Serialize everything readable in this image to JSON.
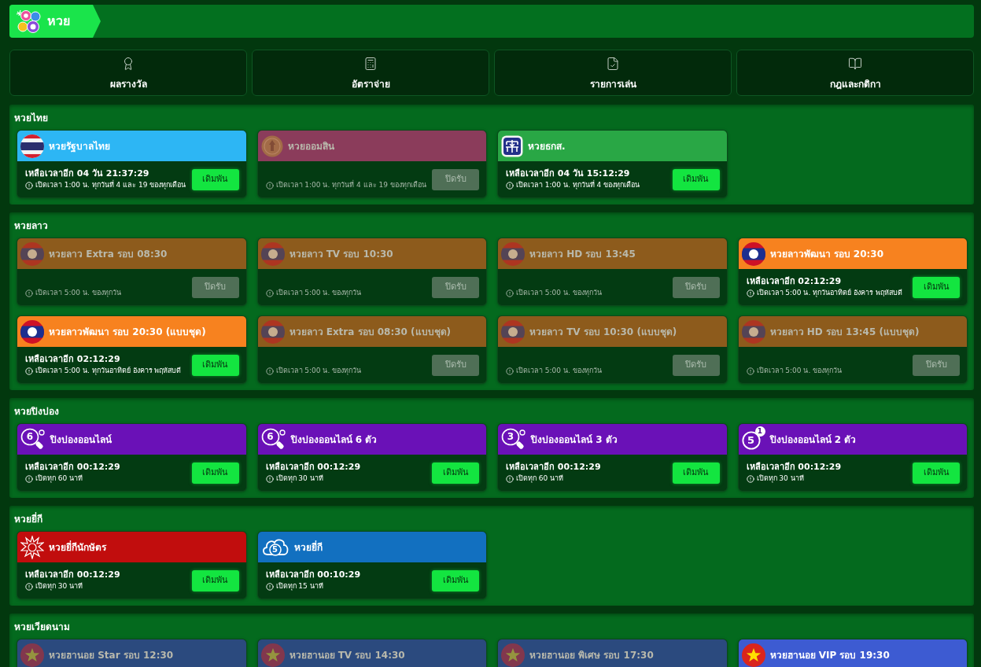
{
  "title_bar": {
    "title": "หวย"
  },
  "nav": [
    {
      "kind": "results",
      "label": "ผลรางวัล"
    },
    {
      "kind": "rates",
      "label": "อัตราจ่าย"
    },
    {
      "kind": "bets",
      "label": "รายการเล่น"
    },
    {
      "kind": "rules",
      "label": "กฎและกติกา"
    }
  ],
  "sections": [
    {
      "title": "หวยไทย",
      "cards": [
        {
          "kind": "thai",
          "name": "หวยรัฐบาลไทย",
          "color": "#2db6f4",
          "open": true,
          "countdown": "เหลือเวลาอีก 04 วัน 21:37:29",
          "schedule": "เปิดเวลา 1:00 น. ทุกวันที่ 4 และ 19 ของทุกเดือน",
          "button": "เดิมพัน"
        },
        {
          "kind": "gsb",
          "name": "หวยออมสิน",
          "color": "#8b3c5b",
          "open": false,
          "schedule": "เปิดเวลา 1:00 น. ทุกวันที่ 4 และ 19 ของทุกเดือน",
          "button": "ปิดรับ"
        },
        {
          "kind": "baac",
          "name": "หวยธกส.",
          "color": "#29a745",
          "open": true,
          "countdown": "เหลือเวลาอีก 04 วัน 15:12:29",
          "schedule": "เปิดเวลา 1:00 น. ทุกวันที่ 4 ของทุกเดือน",
          "button": "เดิมพัน"
        }
      ]
    },
    {
      "title": "หวยลาว",
      "cards": [
        {
          "kind": "lao",
          "name": "หวยลาว Extra รอบ 08:30",
          "color": "#8d5b1c",
          "open": false,
          "schedule": "เปิดเวลา 5:00 น. ของทุกวัน",
          "button": "ปิดรับ"
        },
        {
          "kind": "lao",
          "name": "หวยลาว TV รอบ 10:30",
          "color": "#8d5b1c",
          "open": false,
          "schedule": "เปิดเวลา 5:00 น. ของทุกวัน",
          "button": "ปิดรับ"
        },
        {
          "kind": "lao",
          "name": "หวยลาว HD รอบ 13:45",
          "color": "#8d5b1c",
          "open": false,
          "schedule": "เปิดเวลา 5:00 น. ของทุกวัน",
          "button": "ปิดรับ"
        },
        {
          "kind": "lao",
          "name": "หวยลาวพัฒนา รอบ 20:30",
          "color": "#f7821f",
          "open": true,
          "countdown": "เหลือเวลาอีก 02:12:29",
          "schedule": "เปิดเวลา 5:00 น. ทุกวันอาทิตย์ อังคาร พฤหัสบดี",
          "button": "เดิมพัน"
        },
        {
          "kind": "lao",
          "name": "หวยลาวพัฒนา รอบ 20:30 (แบบชุด)",
          "color": "#f7821f",
          "open": true,
          "countdown": "เหลือเวลาอีก 02:12:29",
          "schedule": "เปิดเวลา 5:00 น. ทุกวันอาทิตย์ อังคาร พฤหัสบดี",
          "button": "เดิมพัน"
        },
        {
          "kind": "lao",
          "name": "หวยลาว Extra รอบ 08:30 (แบบชุด)",
          "color": "#8d5b1c",
          "open": false,
          "schedule": "เปิดเวลา 5:00 น. ของทุกวัน",
          "button": "ปิดรับ"
        },
        {
          "kind": "lao",
          "name": "หวยลาว TV รอบ 10:30 (แบบชุด)",
          "color": "#8d5b1c",
          "open": false,
          "schedule": "เปิดเวลา 5:00 น. ของทุกวัน",
          "button": "ปิดรับ"
        },
        {
          "kind": "lao",
          "name": "หวยลาว HD รอบ 13:45 (แบบชุด)",
          "color": "#8d5b1c",
          "open": false,
          "schedule": "เปิดเวลา 5:00 น. ของทุกวัน",
          "button": "ปิดรับ"
        }
      ]
    },
    {
      "title": "หวยปิงปอง",
      "cards": [
        {
          "kind": "pingpong",
          "icon_text": "6",
          "name": "ปิงปองออนไลน์",
          "color": "#6a11b7",
          "open": true,
          "countdown": "เหลือเวลาอีก 00:12:29",
          "schedule": "เปิดทุก 60 นาที",
          "button": "เดิมพัน"
        },
        {
          "kind": "pingpong",
          "icon_text": "6",
          "name": "ปิงปองออนไลน์ 6 ตัว",
          "color": "#6a11b7",
          "open": true,
          "countdown": "เหลือเวลาอีก 00:12:29",
          "schedule": "เปิดทุก 30 นาที",
          "button": "เดิมพัน"
        },
        {
          "kind": "pingpong",
          "icon_text": "3",
          "name": "ปิงปองออนไลน์ 3 ตัว",
          "color": "#6a11b7",
          "open": true,
          "countdown": "เหลือเวลาอีก 00:12:29",
          "schedule": "เปิดทุก 60 นาที",
          "button": "เดิมพัน"
        },
        {
          "kind": "ring",
          "icon_text": "5",
          "icon_badge": "1",
          "name": "ปิงปองออนไลน์ 2 ตัว",
          "color": "#6a11b7",
          "open": true,
          "countdown": "เหลือเวลาอีก 00:12:29",
          "schedule": "เปิดทุก 30 นาที",
          "button": "เดิมพัน"
        }
      ]
    },
    {
      "title": "หวยยี่กี",
      "cards": [
        {
          "kind": "sunburst",
          "name": "หวยยี่กีนักษัตร",
          "color": "#c10d0d",
          "open": true,
          "countdown": "เหลือเวลาอีก 00:12:29",
          "schedule": "เปิดทุก 30 นาที",
          "button": "เดิมพัน"
        },
        {
          "kind": "cloud",
          "icon_text": "5",
          "name": "หวยยี่กี",
          "color": "#1270c0",
          "open": true,
          "countdown": "เหลือเวลาอีก 00:10:29",
          "schedule": "เปิดทุก 15 นาที",
          "button": "เดิมพัน"
        }
      ]
    },
    {
      "title": "หวยเวียดนาม",
      "cards": [
        {
          "kind": "hanoi",
          "name": "หวยฮานอย Star รอบ 12:30",
          "color": "#2b4a7e",
          "open": false
        },
        {
          "kind": "hanoi",
          "name": "หวยฮานอย TV รอบ 14:30",
          "color": "#2b4a7e",
          "open": false
        },
        {
          "kind": "hanoi",
          "name": "หวยฮานอย พิเศษ รอบ 17:30",
          "color": "#2b4a7e",
          "open": false
        },
        {
          "kind": "hanoi",
          "name": "หวยฮานอย VIP รอบ 19:30",
          "color": "#3d5bd2",
          "open": true
        }
      ]
    }
  ]
}
